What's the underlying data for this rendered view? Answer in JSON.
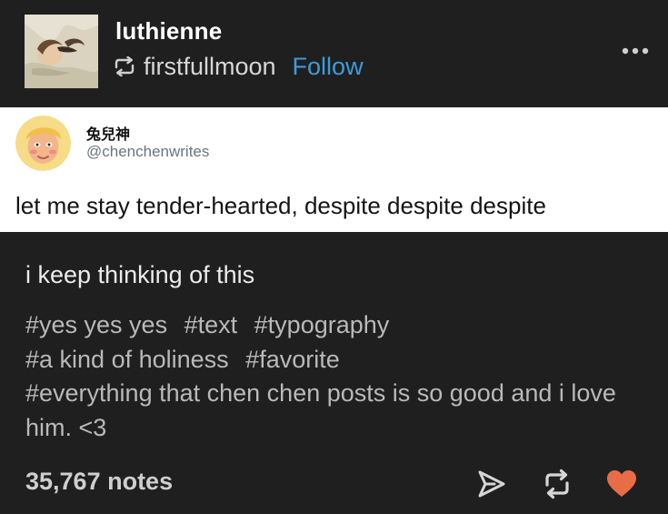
{
  "post": {
    "username": "luthienne",
    "reblogged_from": "firstfullmoon",
    "follow_label": "Follow",
    "more_icon": "ellipsis-icon",
    "reblog_icon": "reblog-icon"
  },
  "tweet": {
    "display_name": "兔兒神",
    "handle": "@chenchenwrites",
    "text": "let me stay tender-hearted, despite despite despite"
  },
  "caption": "i keep thinking of this",
  "tags": [
    "#yes yes yes",
    "#text",
    "#typography",
    "#a kind of holiness",
    "#favorite",
    "#everything that chen chen posts is so good and i love him. <3"
  ],
  "footer": {
    "notes": "35,767 notes",
    "share_icon": "share-icon",
    "reblog_icon": "reblog-icon",
    "like_icon": "heart-icon",
    "like_color": "#e86d47"
  },
  "colors": {
    "background": "#1f1f1f",
    "link": "#3d9bdb",
    "tag": "#b9b9b9"
  }
}
